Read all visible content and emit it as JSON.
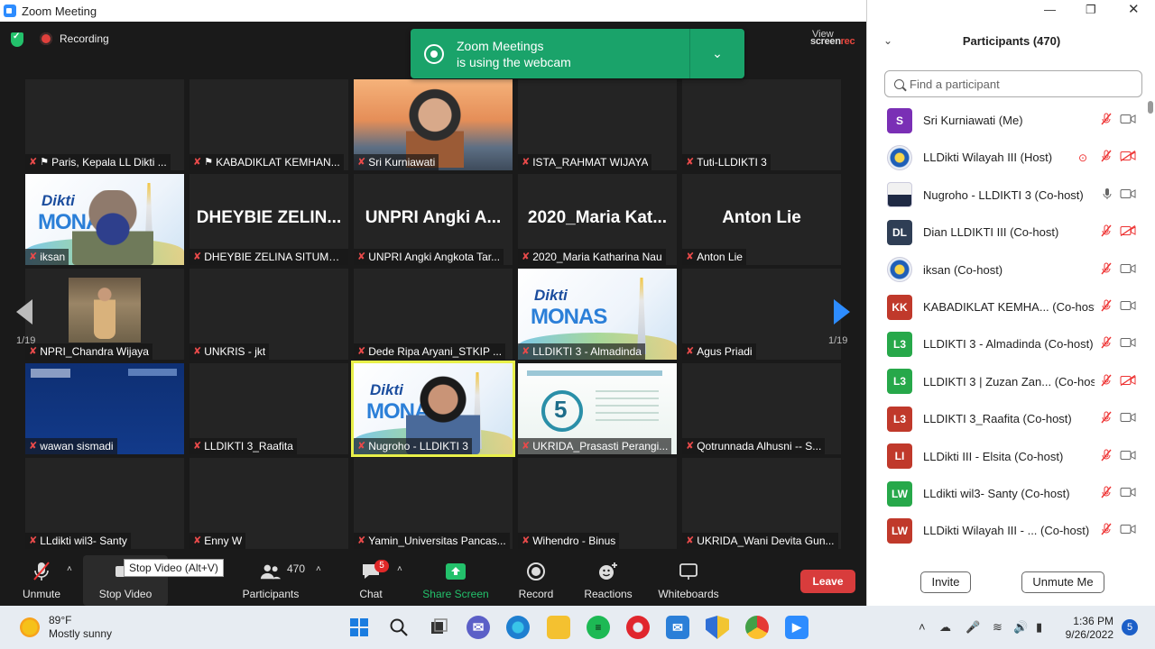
{
  "window": {
    "title": "Zoom Meeting",
    "recording_label": "Recording",
    "view_label": "View",
    "screenrec_prefix": "screen",
    "screenrec_suffix": "rec"
  },
  "toast": {
    "line1": "Zoom Meetings",
    "line2": "is using the webcam"
  },
  "gallery": {
    "page_left": "1/19",
    "page_right": "1/19",
    "tiles": [
      {
        "name": "Paris, Kepala LL Dikti ...",
        "pinned": true,
        "video": "none"
      },
      {
        "name": "KABADIKLAT KEMHAN...",
        "pinned": true,
        "video": "none"
      },
      {
        "name": "Sri Kurniawati",
        "video": "bridge"
      },
      {
        "name": "ISTA_RAHMAT WIJAYA",
        "video": "none"
      },
      {
        "name": "Tuti-LLDIKTI 3",
        "video": "none"
      },
      {
        "name": "iksan",
        "video": "monas-mask"
      },
      {
        "name": "DHEYBIE ZELINA SITUMO...",
        "big": "DHEYBIE ZELIN...",
        "video": "none"
      },
      {
        "name": "UNPRI Angki Angkota Tar...",
        "big": "UNPRI Angki A...",
        "video": "none"
      },
      {
        "name": "2020_Maria Katharina Nau",
        "big": "2020_Maria Kat...",
        "video": "none"
      },
      {
        "name": "Anton Lie",
        "big": "Anton Lie",
        "video": "none"
      },
      {
        "name": "NPRI_Chandra Wijaya",
        "video": "photo"
      },
      {
        "name": "UNKRIS - jkt",
        "video": "none"
      },
      {
        "name": "Dede Ripa Aryani_STKIP ...",
        "video": "none"
      },
      {
        "name": "LLDIKTI 3 - Almadinda",
        "video": "monas"
      },
      {
        "name": "Agus Priadi",
        "video": "none"
      },
      {
        "name": "wawan sismadi",
        "video": "univ"
      },
      {
        "name": "LLDIKTI 3_Raafita",
        "video": "none"
      },
      {
        "name": "Nugroho - LLDIKTI 3",
        "video": "monas-face",
        "active": true
      },
      {
        "name": "UKRIDA_Prasasti Perangi...",
        "video": "web"
      },
      {
        "name": "Qotrunnada Alhusni -- S...",
        "video": "none"
      },
      {
        "name": "LLdikti wil3- Santy",
        "video": "none"
      },
      {
        "name": "Enny W",
        "video": "none"
      },
      {
        "name": "Yamin_Universitas Pancas...",
        "video": "none"
      },
      {
        "name": "Wihendro - Binus",
        "video": "none"
      },
      {
        "name": "UKRIDA_Wani Devita Gun...",
        "video": "none"
      }
    ],
    "monas_text": {
      "dikti": "Dikti",
      "monas": "MONAS"
    },
    "web_text": "5"
  },
  "toolbar": {
    "unmute": "Unmute",
    "stop_video": "Stop Video",
    "participants": "Participants",
    "participant_count": "470",
    "chat": "Chat",
    "chat_badge": "5",
    "share_screen": "Share Screen",
    "record": "Record",
    "reactions": "Reactions",
    "whiteboards": "Whiteboards",
    "leave": "Leave",
    "tooltip": "Stop Video (Alt+V)"
  },
  "panel": {
    "title": "Participants (470)",
    "search_placeholder": "Find a participant",
    "invite": "Invite",
    "unmute_me": "Unmute Me",
    "participants": [
      {
        "avatar": "S",
        "color": "#7a2fb5",
        "name": "Sri Kurniawati (Me)",
        "mic": "off",
        "cam": "on"
      },
      {
        "avatar": "",
        "color": "",
        "name": "LLDikti Wilayah III (Host)",
        "mic": "off",
        "cam": "off",
        "spotlight": true
      },
      {
        "avatar": "",
        "color": "",
        "name": "Nugroho - LLDIKTI 3 (Co-host)",
        "mic": "on",
        "cam": "on"
      },
      {
        "avatar": "DL",
        "color": "#2f3e55",
        "name": "Dian LLDIKTI III (Co-host)",
        "mic": "off",
        "cam": "off"
      },
      {
        "avatar": "",
        "color": "",
        "name": "iksan (Co-host)",
        "mic": "off",
        "cam": "on"
      },
      {
        "avatar": "KK",
        "color": "#c0392b",
        "name": "KABADIKLAT KEMHA... (Co-host)",
        "mic": "off",
        "cam": "on"
      },
      {
        "avatar": "L3",
        "color": "#27a84a",
        "name": "LLDIKTI 3 - Almadinda (Co-host)",
        "mic": "off",
        "cam": "on"
      },
      {
        "avatar": "L3",
        "color": "#27a84a",
        "name": "LLDIKTI 3 | Zuzan Zan... (Co-host)",
        "mic": "off",
        "cam": "off"
      },
      {
        "avatar": "L3",
        "color": "#c0392b",
        "name": "LLDIKTI 3_Raafita (Co-host)",
        "mic": "off",
        "cam": "on"
      },
      {
        "avatar": "LI",
        "color": "#c0392b",
        "name": "LLDikti III - Elsita (Co-host)",
        "mic": "off",
        "cam": "on"
      },
      {
        "avatar": "LW",
        "color": "#27a84a",
        "name": "LLdikti wil3- Santy (Co-host)",
        "mic": "off",
        "cam": "on"
      },
      {
        "avatar": "LW",
        "color": "#c0392b",
        "name": "LLDikti Wilayah III - ... (Co-host)",
        "mic": "off",
        "cam": "on"
      }
    ]
  },
  "taskbar": {
    "temp": "89°F",
    "weather": "Mostly sunny",
    "time": "1:36 PM",
    "date": "9/26/2022",
    "notifications": "5"
  }
}
